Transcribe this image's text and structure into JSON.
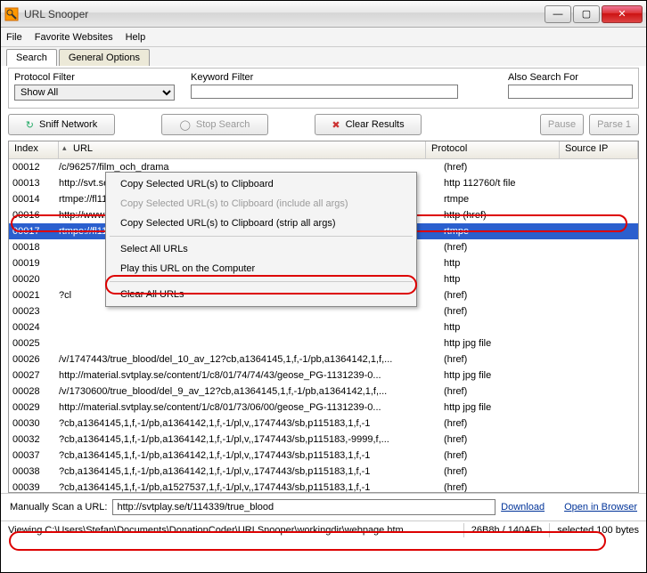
{
  "window": {
    "title": "URL Snooper"
  },
  "menu": {
    "file": "File",
    "favs": "Favorite Websites",
    "help": "Help"
  },
  "tabs": {
    "search": "Search",
    "general": "General Options"
  },
  "filters": {
    "protocol_label": "Protocol Filter",
    "protocol_value": "Show All",
    "keyword_label": "Keyword Filter",
    "keyword_value": "",
    "also_label": "Also Search For",
    "also_value": ""
  },
  "toolbar": {
    "sniff": "Sniff Network",
    "stop": "Stop Search",
    "clear": "Clear Results",
    "pause": "Pause",
    "parse": "Parse 1"
  },
  "columns": {
    "index": "Index",
    "url": "URL",
    "protocol": "Protocol",
    "source": "Source IP"
  },
  "rows": [
    {
      "idx": "00012",
      "url": "/c/96257/film_och_drama",
      "proto": "(href)"
    },
    {
      "idx": "00013",
      "url": "http://svt.se/2.112760",
      "proto": "http 112760/t file"
    },
    {
      "idx": "00014",
      "url": "rtmpe://fl11.c90909.cdn.qbrick.com/90909/_definst_/kluster/20091027/ge...",
      "proto": "rtmpe"
    },
    {
      "idx": "00016",
      "url": "http://www.adobe.com/go/getflashplayer",
      "proto": "http (href)"
    },
    {
      "idx": "00017",
      "url": "rtmpe://fl11.c90909.cdn.qbrick.com/90909/_definst_/kluster/20091027/ge...",
      "proto": "rtmpe",
      "sel": true
    },
    {
      "idx": "00018",
      "url": "",
      "proto": "(href)"
    },
    {
      "idx": "00019",
      "url": "",
      "proto": "http"
    },
    {
      "idx": "00020",
      "url": "",
      "proto": "http"
    },
    {
      "idx": "00021",
      "url": "?cl",
      "proto": "(href)"
    },
    {
      "idx": "00023",
      "url": "",
      "proto": "(href)"
    },
    {
      "idx": "00024",
      "url": "",
      "proto": "http"
    },
    {
      "idx": "00025",
      "url": "",
      "proto": "http jpg file"
    },
    {
      "idx": "00026",
      "url": "/v/1747443/true_blood/del_10_av_12?cb,a1364145,1,f,-1/pb,a1364142,1,f,...",
      "proto": "(href)"
    },
    {
      "idx": "00027",
      "url": "http://material.svtplay.se/content/1/c8/01/74/74/43/geose_PG-1131239-0...",
      "proto": "http jpg file"
    },
    {
      "idx": "00028",
      "url": "/v/1730600/true_blood/del_9_av_12?cb,a1364145,1,f,-1/pb,a1364142,1,f,...",
      "proto": "(href)"
    },
    {
      "idx": "00029",
      "url": "http://material.svtplay.se/content/1/c8/01/73/06/00/geose_PG-1131239-0...",
      "proto": "http jpg file"
    },
    {
      "idx": "00030",
      "url": "?cb,a1364145,1,f,-1/pb,a1364142,1,f,-1/pl,v,,1747443/sb,p115183,1,f,-1",
      "proto": "(href)"
    },
    {
      "idx": "00032",
      "url": "?cb,a1364145,1,f,-1/pb,a1364142,1,f,-1/pl,v,,1747443/sb,p115183,-9999,f,...",
      "proto": "(href)"
    },
    {
      "idx": "00037",
      "url": "?cb,a1364145,1,f,-1/pb,a1364142,1,f,-1/pl,v,,1747443/sb,p115183,1,f,-1",
      "proto": "(href)"
    },
    {
      "idx": "00038",
      "url": "?cb,a1364145,1,f,-1/pb,a1364142,1,f,-1/pl,v,,1747443/sb,p115183,1,f,-1",
      "proto": "(href)"
    },
    {
      "idx": "00039",
      "url": "?cb,a1364145,1,f,-1/pb,a1527537,1,f,-1/pl,v,,1747443/sb,p115183,1,f,-1",
      "proto": "(href)"
    }
  ],
  "contextmenu": {
    "copy": "Copy Selected URL(s) to Clipboard",
    "copy_all_args": "Copy Selected URL(s) to Clipboard (include all args)",
    "copy_strip": "Copy Selected URL(s) to Clipboard (strip all args)",
    "select_all": "Select All URLs",
    "play": "Play this URL on the Computer",
    "clear_all": "Clear All URLs"
  },
  "scan": {
    "label": "Manually Scan a URL:",
    "value": "http://svtplay.se/t/114339/true_blood",
    "download": "Download",
    "open": "Open in Browser"
  },
  "status": {
    "path": "Viewing C:\\Users\\Stefan\\Documents\\DonationCoder\\URLSnooper\\workingdir\\webpage.htm",
    "mid": "26B8h / 140AFh",
    "sel": "selected 100 bytes"
  }
}
